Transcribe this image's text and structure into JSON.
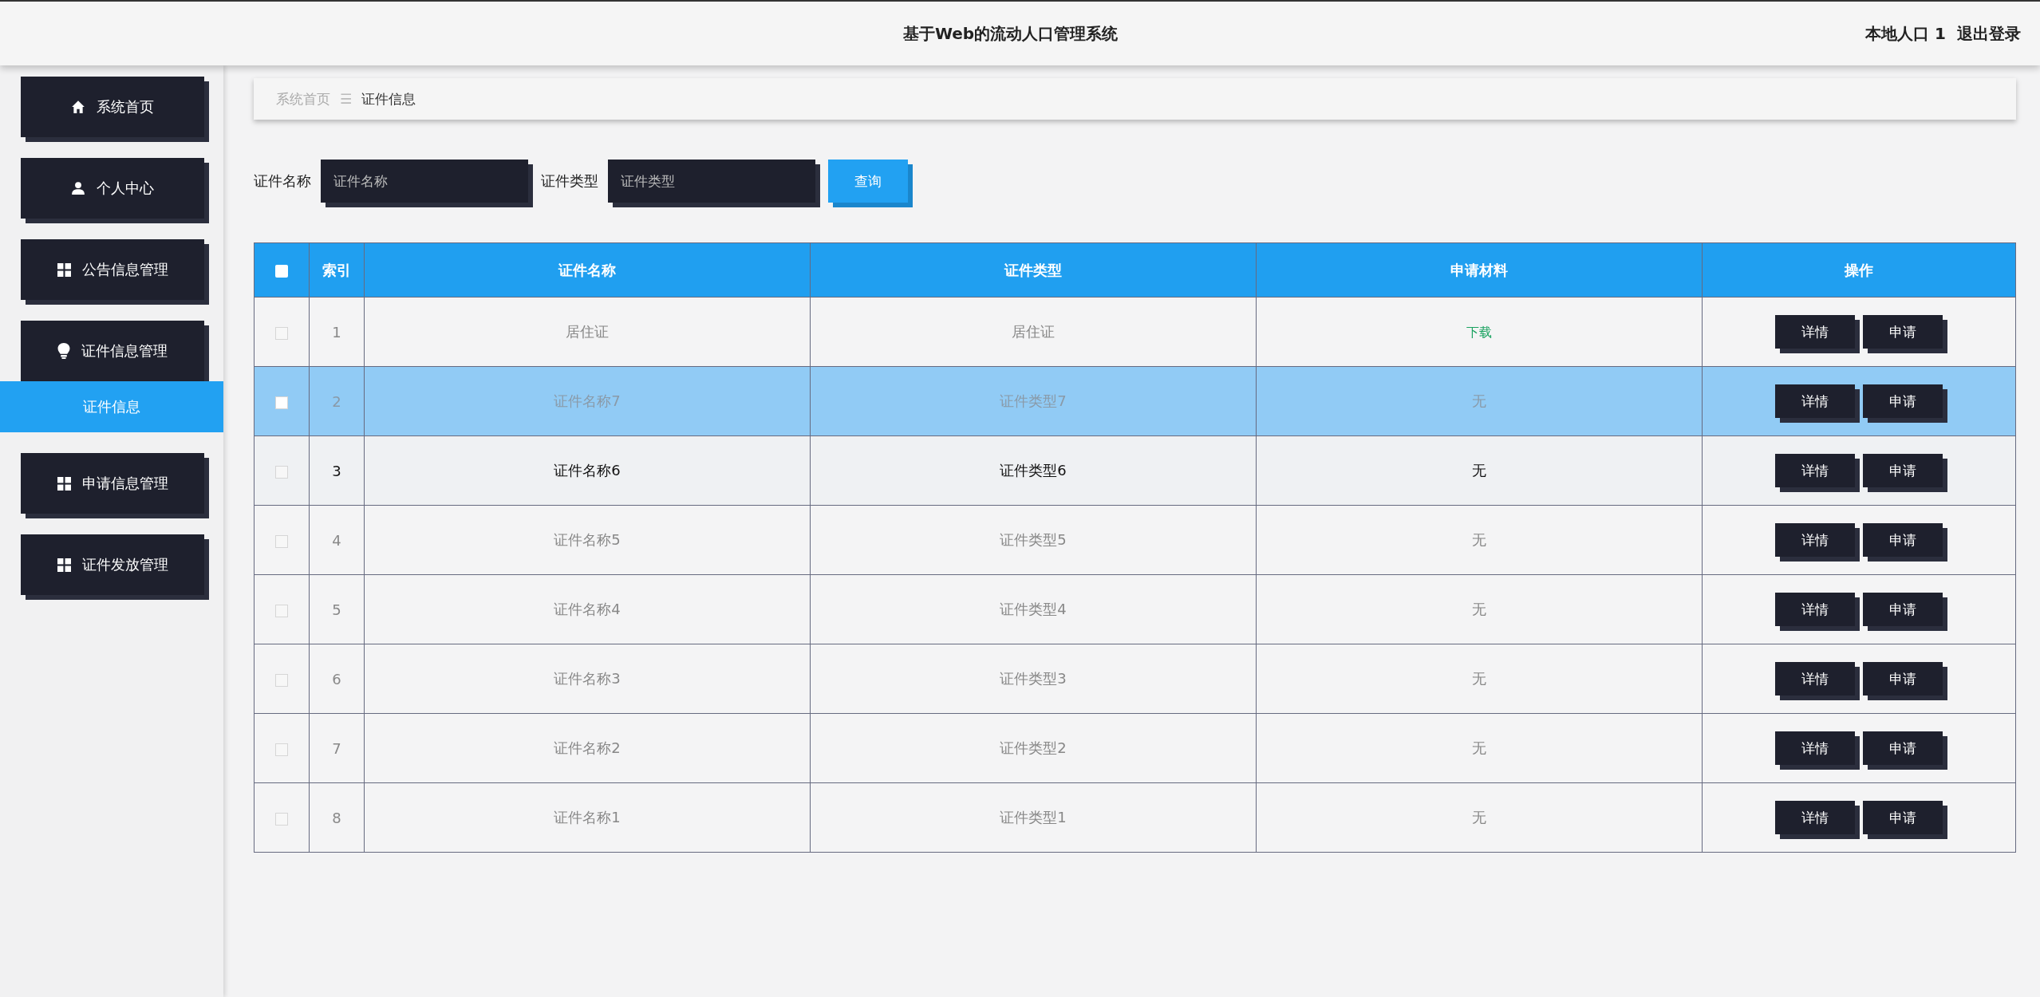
{
  "header": {
    "title": "基于Web的流动人口管理系统",
    "user": "本地人口 1",
    "logout": "退出登录"
  },
  "sidebar": {
    "items": [
      {
        "label": "系统首页",
        "kind": "home",
        "selected": false
      },
      {
        "label": "个人中心",
        "kind": "user",
        "selected": false
      },
      {
        "label": "公告信息管理",
        "kind": "grid",
        "selected": false
      },
      {
        "label": "证件信息管理",
        "kind": "bulb",
        "selected": false,
        "children": [
          {
            "label": "证件信息",
            "selected": true
          }
        ]
      },
      {
        "label": "申请信息管理",
        "kind": "grid",
        "selected": false
      },
      {
        "label": "证件发放管理",
        "kind": "grid",
        "selected": false
      }
    ]
  },
  "breadcrumb": {
    "items": [
      "系统首页",
      "证件信息"
    ],
    "separator": "☰"
  },
  "search": {
    "fields": [
      {
        "label": "证件名称",
        "placeholder": "证件名称"
      },
      {
        "label": "证件类型",
        "placeholder": "证件类型"
      }
    ],
    "button": "查询"
  },
  "table": {
    "select_all_checked": false,
    "columns": [
      "索引",
      "证件名称",
      "证件类型",
      "申请材料",
      "操作"
    ],
    "rows": [
      {
        "index": "1",
        "name": "居住证",
        "type": "居住证",
        "material": {
          "kind": "link",
          "text": "下载"
        },
        "selected": false,
        "hovered": false,
        "checked": false,
        "actions": [
          "详情",
          "申请"
        ]
      },
      {
        "index": "2",
        "name": "证件名称7",
        "type": "证件类型7",
        "material": {
          "kind": "text",
          "text": "无"
        },
        "selected": true,
        "hovered": false,
        "checked": false,
        "actions": [
          "详情",
          "申请"
        ]
      },
      {
        "index": "3",
        "name": "证件名称6",
        "type": "证件类型6",
        "material": {
          "kind": "text",
          "text": "无"
        },
        "selected": false,
        "hovered": true,
        "checked": false,
        "actions": [
          "详情",
          "申请"
        ]
      },
      {
        "index": "4",
        "name": "证件名称5",
        "type": "证件类型5",
        "material": {
          "kind": "text",
          "text": "无"
        },
        "selected": false,
        "hovered": false,
        "checked": false,
        "actions": [
          "详情",
          "申请"
        ]
      },
      {
        "index": "5",
        "name": "证件名称4",
        "type": "证件类型4",
        "material": {
          "kind": "text",
          "text": "无"
        },
        "selected": false,
        "hovered": false,
        "checked": false,
        "actions": [
          "详情",
          "申请"
        ]
      },
      {
        "index": "6",
        "name": "证件名称3",
        "type": "证件类型3",
        "material": {
          "kind": "text",
          "text": "无"
        },
        "selected": false,
        "hovered": false,
        "checked": false,
        "actions": [
          "详情",
          "申请"
        ]
      },
      {
        "index": "7",
        "name": "证件名称2",
        "type": "证件类型2",
        "material": {
          "kind": "text",
          "text": "无"
        },
        "selected": false,
        "hovered": false,
        "checked": false,
        "actions": [
          "详情",
          "申请"
        ]
      },
      {
        "index": "8",
        "name": "证件名称1",
        "type": "证件类型1",
        "material": {
          "kind": "text",
          "text": "无"
        },
        "selected": false,
        "hovered": false,
        "checked": false,
        "actions": [
          "详情",
          "申请"
        ]
      }
    ]
  }
}
